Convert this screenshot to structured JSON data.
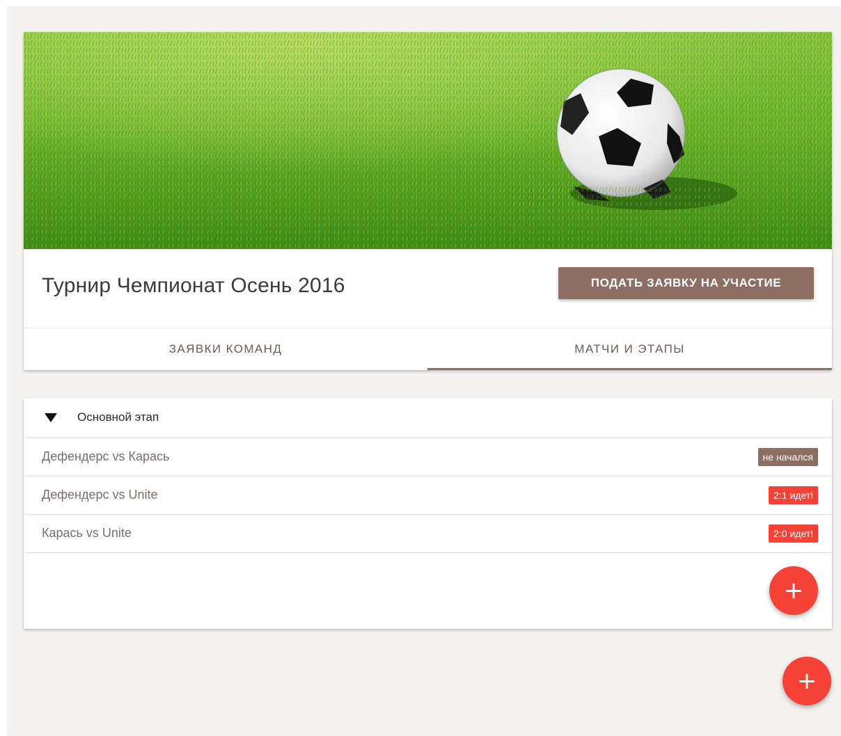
{
  "tournament": {
    "title": "Турнир Чемпионат Осень 2016",
    "apply_label": "ПОДАТЬ ЗАЯВКУ НА УЧАСТИЕ",
    "hero_image": "soccer-ball-on-grass"
  },
  "tabs": [
    {
      "label": "ЗАЯВКИ КОМАНД",
      "active": false
    },
    {
      "label": "МАТЧИ И ЭТАПЫ",
      "active": true
    }
  ],
  "stage": {
    "name": "Основной этап",
    "expanded": true,
    "matches": [
      {
        "name": "Дефендерс vs Карась",
        "status": "не начался",
        "status_color": "#8d6e63"
      },
      {
        "name": "Дефендерс vs Unite",
        "status": "2:1 идет!",
        "status_color": "#f44336"
      },
      {
        "name": "Карась vs Unite",
        "status": "2:0 идет!",
        "status_color": "#f44336"
      }
    ],
    "add_icon": "+"
  },
  "page_fab": {
    "icon": "+"
  },
  "colors": {
    "accent_brown": "#8d6e63",
    "fab_red": "#f44336",
    "background": "#f3f2ef"
  }
}
